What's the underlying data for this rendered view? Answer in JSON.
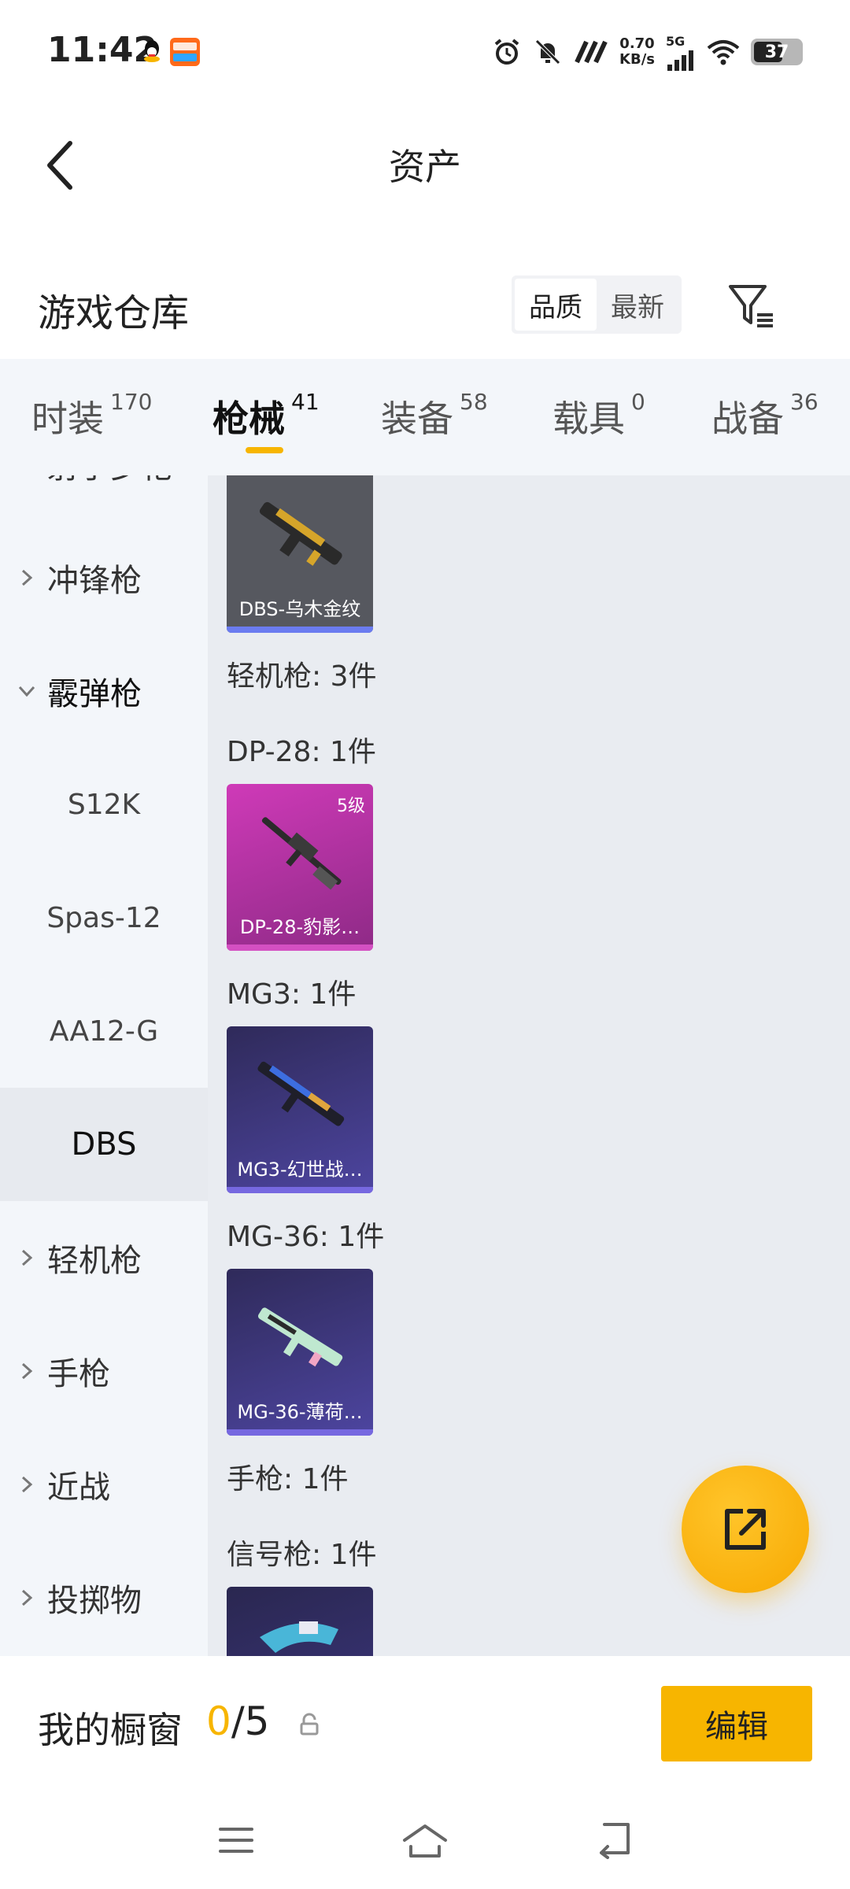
{
  "status_bar": {
    "time": "11:42",
    "net_speed_value": "0.70",
    "net_speed_unit": "KB/s",
    "network": "5G",
    "battery": "37",
    "icons": [
      "qq-icon",
      "taobao-icon",
      "alarm-icon",
      "mute-icon",
      "nfc-icon",
      "signal-icon",
      "wifi-icon",
      "battery-icon"
    ]
  },
  "header": {
    "title": "资产",
    "back_icon": "chevron-left-icon"
  },
  "warehouse": {
    "title": "游戏仓库",
    "sort_options": [
      "品质",
      "最新"
    ],
    "active_sort": "品质",
    "filter_icon": "filter-icon"
  },
  "tabs": [
    {
      "label": "时装",
      "count": "170"
    },
    {
      "label": "枪械",
      "count": "41"
    },
    {
      "label": "装备",
      "count": "58"
    },
    {
      "label": "载具",
      "count": "0"
    },
    {
      "label": "战备",
      "count": "36"
    }
  ],
  "active_tab": "枪械",
  "sidebar": {
    "items": [
      {
        "label": "射手步枪",
        "type": "category"
      },
      {
        "label": "冲锋枪",
        "type": "category"
      },
      {
        "label": "霰弹枪",
        "type": "category-expanded"
      },
      {
        "label": "S12K",
        "type": "sub"
      },
      {
        "label": "Spas-12",
        "type": "sub"
      },
      {
        "label": "AA12-G",
        "type": "sub"
      },
      {
        "label": "DBS",
        "type": "sub-selected"
      },
      {
        "label": "轻机枪",
        "type": "category"
      },
      {
        "label": "手枪",
        "type": "category"
      },
      {
        "label": "近战",
        "type": "category"
      },
      {
        "label": "投掷物",
        "type": "category"
      }
    ]
  },
  "content": {
    "groups": [
      {
        "label": "轻机枪: 3件"
      },
      {
        "label": "DP-28: 1件"
      },
      {
        "label": "MG3: 1件"
      },
      {
        "label": "MG-36: 1件"
      },
      {
        "label": "手枪: 1件"
      },
      {
        "label": "信号枪: 1件"
      }
    ],
    "cards": [
      {
        "name": "DBS-乌木金纹",
        "level": "",
        "bg": "#56585f",
        "bar": "#6b7cf0"
      },
      {
        "name": "DP-28-豹影…",
        "level": "5级",
        "bg": "#b2329e",
        "bar": "#d450c2"
      },
      {
        "name": "MG3-幻世战…",
        "level": "",
        "bg": "#3b3373",
        "bar": "#7668e0"
      },
      {
        "name": "MG-36-薄荷…",
        "level": "",
        "bg": "#3d3678",
        "bar": "#7668e0"
      },
      {
        "name": "",
        "level": "",
        "bg": "#2f2c5e",
        "bar": "#7668e0"
      }
    ]
  },
  "fab": {
    "icon": "share-icon"
  },
  "showcase": {
    "label": "我的橱窗",
    "current": "0",
    "max": "/5",
    "lock_icon": "lock-icon",
    "edit_label": "编辑"
  },
  "nav_bar": {
    "icons": [
      "menu-icon",
      "home-icon",
      "back-icon"
    ]
  }
}
